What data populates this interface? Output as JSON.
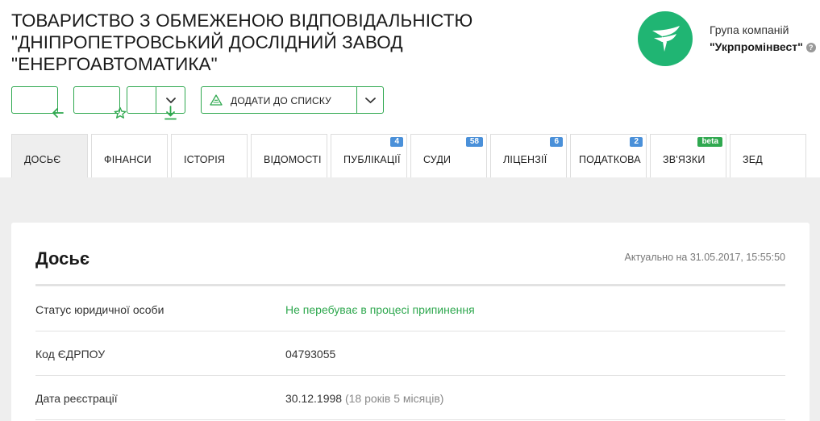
{
  "company": {
    "title": "ТОВАРИСТВО З ОБМЕЖЕНОЮ ВІДПОВІДАЛЬНІСТЮ \"ДНІПРОПЕТРОВСЬКИЙ ДОСЛІДНИЙ ЗАВОД \"ЕНЕРГОАВТОМАТИКА\"",
    "group_label": "Група компаній",
    "group_name": "\"Укрпромінвест\"",
    "help_glyph": "?"
  },
  "toolbar": {
    "add_to_list_label": "ДОДАТИ ДО СПИСКУ"
  },
  "tabs": [
    {
      "label": "ДОСЬЄ",
      "badge": ""
    },
    {
      "label": "ФІНАНСИ",
      "badge": ""
    },
    {
      "label": "ІСТОРІЯ",
      "badge": ""
    },
    {
      "label": "ВІДОМОСТІ",
      "badge": ""
    },
    {
      "label": "ПУБЛІКАЦІЇ",
      "badge": "4"
    },
    {
      "label": "СУДИ",
      "badge": "58"
    },
    {
      "label": "ЛІЦЕНЗІЇ",
      "badge": "6"
    },
    {
      "label": "ПОДАТКОВА",
      "badge": "2"
    },
    {
      "label": "ЗВ'ЯЗКИ",
      "badge": "beta"
    },
    {
      "label": "ЗЕД",
      "badge": ""
    }
  ],
  "dossier": {
    "title": "Досьє",
    "actual": "Актуально на 31.05.2017, 15:55:50",
    "rows": [
      {
        "label": "Статус юридичної особи",
        "value": "Не перебуває в процесі припинення",
        "sub": ""
      },
      {
        "label": "Код ЄДРПОУ",
        "value": "04793055",
        "sub": ""
      },
      {
        "label": "Дата реєстрації",
        "value": "30.12.1998",
        "sub": "(18 років 5 місяців)"
      }
    ]
  },
  "colors": {
    "brand_green": "#2fa84f",
    "logo_green": "#20b573",
    "badge_blue": "#4a90d9",
    "background_gray": "#eeeeee"
  },
  "icons": {
    "back": "arrow-left-icon",
    "favorite": "star-icon",
    "download": "download-icon",
    "dropdown": "chevron-down-icon",
    "list": "triangle-list-icon",
    "help": "question-circle-icon"
  }
}
